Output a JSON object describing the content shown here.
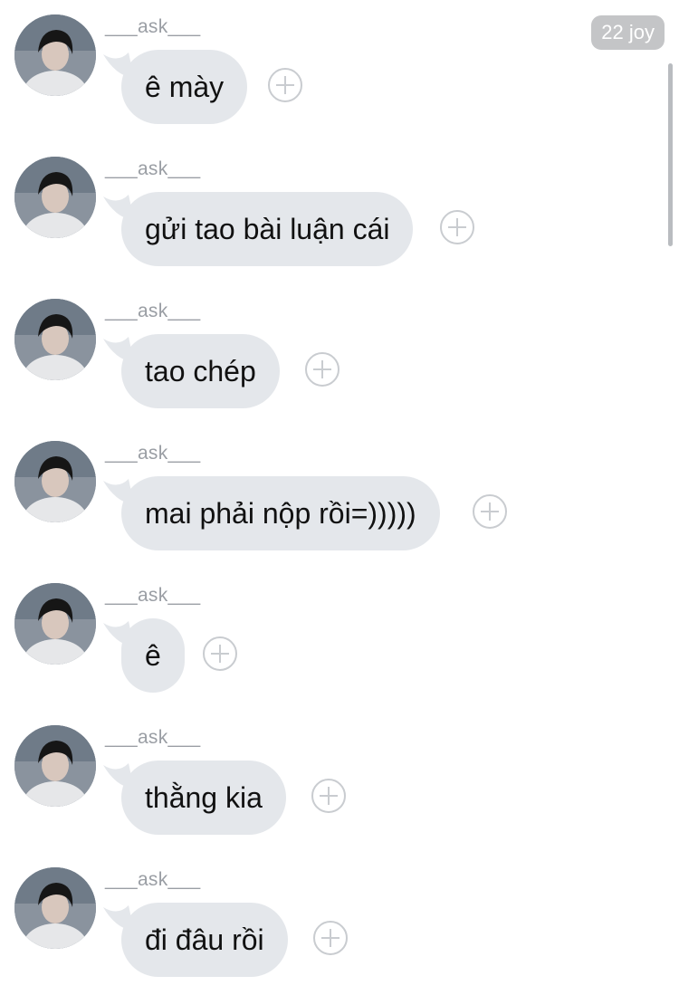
{
  "badge": "22 joy",
  "messages": [
    {
      "sender": "___ask___",
      "text": "ê mày",
      "avatar": "profile-photo"
    },
    {
      "sender": "___ask___",
      "text": "gửi tao bài luận cái",
      "avatar": "profile-photo"
    },
    {
      "sender": "___ask___",
      "text": "tao chép",
      "avatar": "profile-photo"
    },
    {
      "sender": "___ask___",
      "text": "mai phải nộp rồi=)))))",
      "avatar": "profile-photo"
    },
    {
      "sender": "___ask___",
      "text": "ê",
      "avatar": "profile-photo"
    },
    {
      "sender": "___ask___",
      "text": "thằng kia",
      "avatar": "profile-photo"
    },
    {
      "sender": "___ask___",
      "text": "đi đâu rồi",
      "avatar": "profile-photo"
    }
  ],
  "icons": {
    "react": "plus-circle-icon",
    "tail": "bubble-tail"
  },
  "colors": {
    "bubble": "#e4e7eb",
    "sender": "#9a9ea4",
    "badge_bg": "#c4c5c7",
    "react_ring": "#c9ccd0"
  }
}
